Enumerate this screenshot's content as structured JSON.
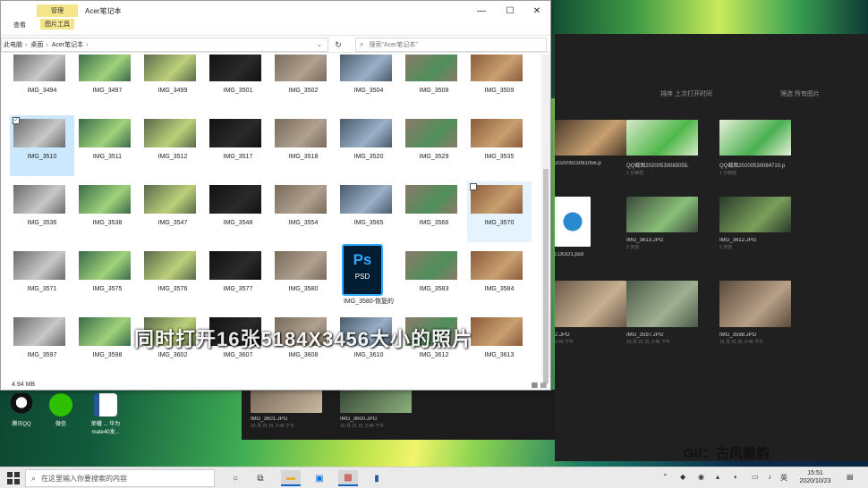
{
  "explorer": {
    "title": "Acer笔记本",
    "manage_tab": "管理",
    "tabs": [
      "查看",
      "图片工具"
    ],
    "window_controls": {
      "minimize": "—",
      "maximize": "☐",
      "close": "✕"
    },
    "breadcrumb": [
      "此电脑",
      "桌面",
      "Acer笔记本"
    ],
    "search_placeholder": "搜索\"Acer笔记本\"",
    "status": "4.94 MB",
    "files": [
      "IMG_3494",
      "IMG_3497",
      "IMG_3499",
      "IMG_3501",
      "IMG_3502",
      "IMG_3504",
      "IMG_3508",
      "IMG_3509",
      "IMG_3510",
      "IMG_3511",
      "IMG_3512",
      "IMG_3517",
      "IMG_3518",
      "IMG_3520",
      "IMG_3529",
      "IMG_3535",
      "IMG_3536",
      "IMG_3538",
      "IMG_3547",
      "IMG_3548",
      "IMG_3554",
      "IMG_3565",
      "IMG_3566",
      "IMG_3570",
      "IMG_3571",
      "IMG_3575",
      "IMG_3576",
      "IMG_3577",
      "IMG_3580",
      "IMG_3580-恢复的",
      "IMG_3583",
      "IMG_3584",
      "IMG_3597",
      "IMG_3598",
      "IMG_3602",
      "IMG_3607",
      "IMG_3608",
      "IMG_3610",
      "IMG_3612",
      "IMG_3613"
    ],
    "psd_label": "PSD",
    "psd_letters": "Ps"
  },
  "overlay_caption": "同时打开16张5184X3456大小的照片",
  "viewer": {
    "sort_label": "排序  上次打开时间",
    "filter_label": "筛选   所有图片",
    "tiles": [
      {
        "name": "20200923091056.p",
        "date": ""
      },
      {
        "name": "QQ截图20200530085055.",
        "date": "1 分钟前"
      },
      {
        "name": "QQ截图20200530084710.p",
        "date": "1 分钟前"
      },
      {
        "name": "LOGO1.psd",
        "date": ""
      },
      {
        "name": "IMG_3613.JPG",
        "date": "2 天前"
      },
      {
        "name": "IMG_3612.JPG",
        "date": "2 天前"
      },
      {
        "name": "2.JPG",
        "date": "2:46 下午"
      },
      {
        "name": "IMG_3597.JPG",
        "date": "10 月 21 日, 2:46 下午"
      },
      {
        "name": "IMG_3598.JPG",
        "date": "10 月 21 日, 2:46 下午"
      },
      {
        "name": "IMG_3601.JPG",
        "date": "10 月 21 日, 2:46 下午"
      },
      {
        "name": "IMG_3600.JPG",
        "date": "10 月 21 日, 2:46 下午"
      }
    ]
  },
  "desktop_icons": [
    "腾讯QQ",
    "微信",
    "荣耀 ... 华为mate40发..."
  ],
  "watermark": "Gif：古风徽韵",
  "taskbar": {
    "search_placeholder": "在这里输入你要搜索的内容",
    "ime": "英",
    "time": "15:51",
    "date": "2020/10/23"
  }
}
